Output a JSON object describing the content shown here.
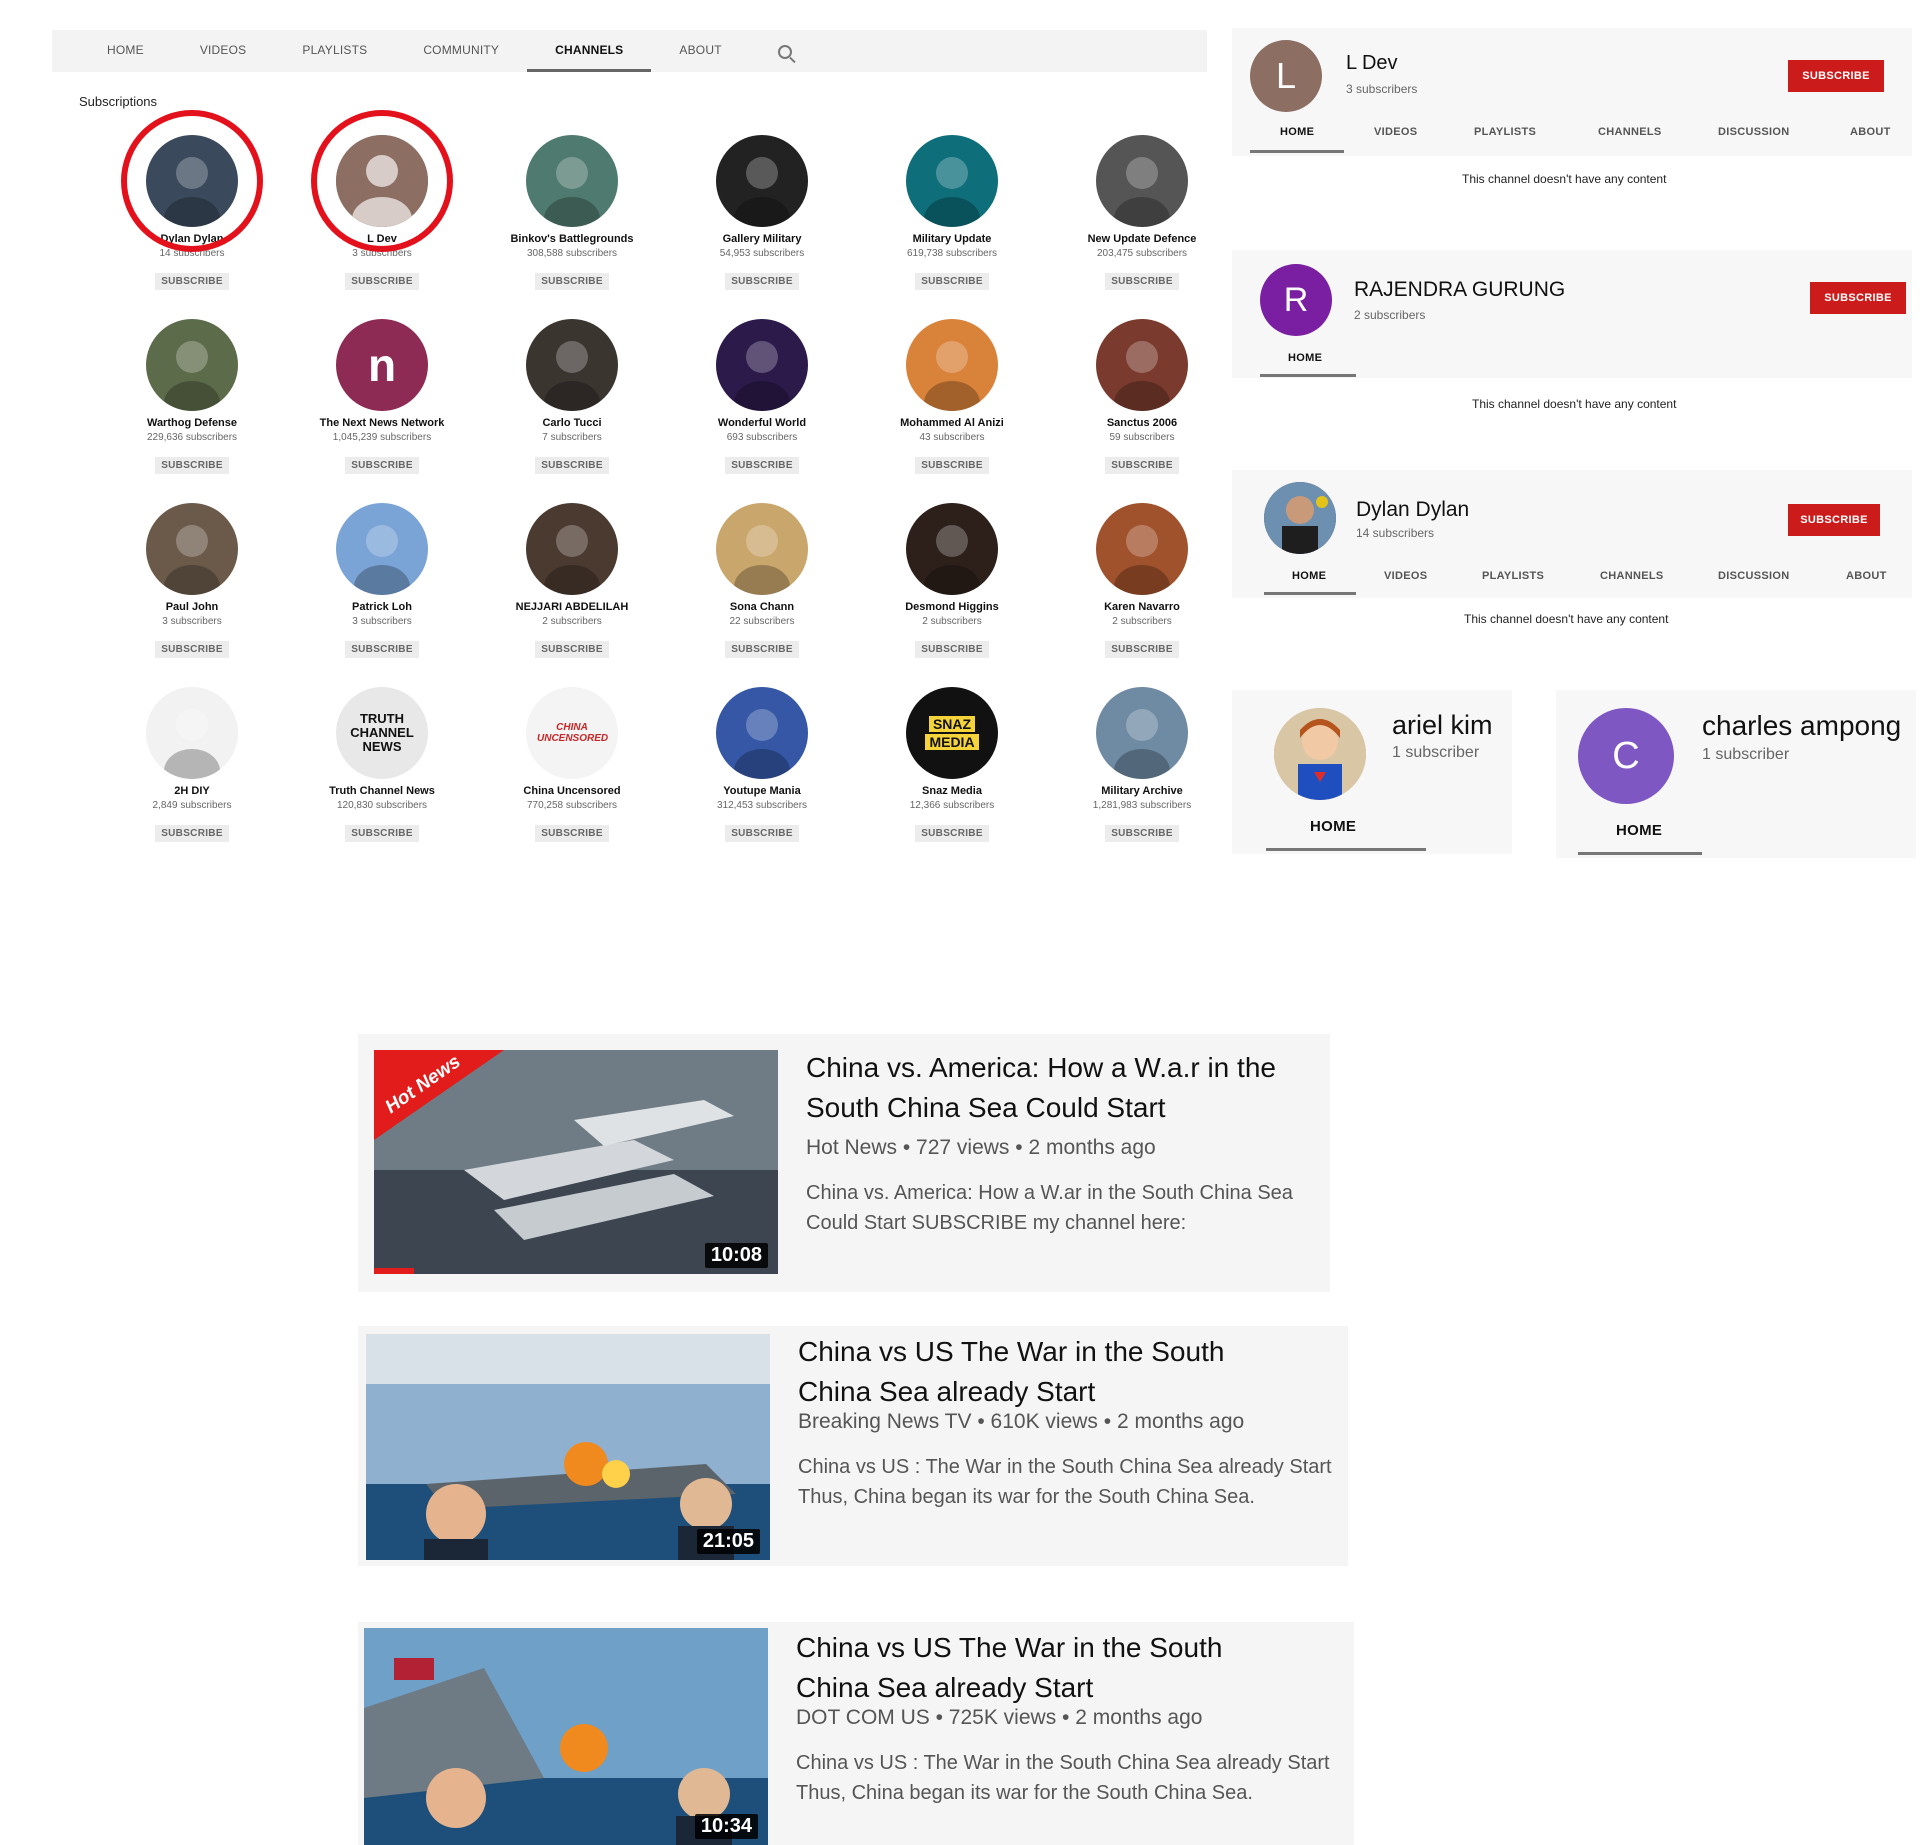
{
  "nav": {
    "tabs": [
      "HOME",
      "VIDEOS",
      "PLAYLISTS",
      "COMMUNITY",
      "CHANNELS",
      "ABOUT"
    ],
    "active_tab": "CHANNELS"
  },
  "subscriptions_heading": "Subscriptions",
  "subscribe_label": "SUBSCRIBE",
  "channels": [
    {
      "name": "Dylan Dylan",
      "subs": "14 subscribers",
      "color": "#3a4a5c"
    },
    {
      "name": "L Dev",
      "subs": "3 subscribers",
      "color": "#8d6e63"
    },
    {
      "name": "Binkov's Battlegrounds",
      "subs": "308,588 subscribers",
      "color": "#4f7a6f"
    },
    {
      "name": "Gallery Military",
      "subs": "54,953 subscribers",
      "color": "#222222"
    },
    {
      "name": "Military Update",
      "subs": "619,738 subscribers",
      "color": "#0e6e7a"
    },
    {
      "name": "New Update Defence",
      "subs": "203,475 subscribers",
      "color": "#555555"
    },
    {
      "name": "Warthog Defense",
      "subs": "229,636 subscribers",
      "color": "#5c6b4a"
    },
    {
      "name": "The Next News Network",
      "subs": "1,045,239 subscribers",
      "color": "#8e2b55"
    },
    {
      "name": "Carlo Tucci",
      "subs": "7 subscribers",
      "color": "#3b3530"
    },
    {
      "name": "Wonderful World",
      "subs": "693 subscribers",
      "color": "#2c1a4a"
    },
    {
      "name": "Mohammed Al Anizi",
      "subs": "43 subscribers",
      "color": "#d9823a"
    },
    {
      "name": "Sanctus 2006",
      "subs": "59 subscribers",
      "color": "#7a3b2e"
    },
    {
      "name": "Paul John",
      "subs": "3 subscribers",
      "color": "#6b5a4a"
    },
    {
      "name": "Patrick Loh",
      "subs": "3 subscribers",
      "color": "#7aa3d6"
    },
    {
      "name": "NEJJARI ABDELILAH",
      "subs": "2 subscribers",
      "color": "#4a3a30"
    },
    {
      "name": "Sona Chann",
      "subs": "22 subscribers",
      "color": "#c9a66b"
    },
    {
      "name": "Desmond Higgins",
      "subs": "2 subscribers",
      "color": "#2d1f1a"
    },
    {
      "name": "Karen Navarro",
      "subs": "2 subscribers",
      "color": "#a0522d"
    },
    {
      "name": "2H DIY",
      "subs": "2,849 subscribers",
      "color": "#f2f2f2"
    },
    {
      "name": "Truth Channel News",
      "subs": "120,830 subscribers",
      "color": "#e8e8e8"
    },
    {
      "name": "China Uncensored",
      "subs": "770,258 subscribers",
      "color": "#f4f4f4"
    },
    {
      "name": "Youtupe Mania",
      "subs": "312,453 subscribers",
      "color": "#3557a6"
    },
    {
      "name": "Snaz Media",
      "subs": "12,366 subscribers",
      "color": "#111111"
    },
    {
      "name": "Military Archive",
      "subs": "1,281,983 subscribers",
      "color": "#6f8aa3"
    }
  ],
  "avatar_texts": {
    "truth": "TRUTH CHANNEL NEWS",
    "china": "CHINA UNCENSORED",
    "snaz1": "SNAZ",
    "snaz2": "MEDIA",
    "nnn": "n"
  },
  "ldev_panel": {
    "initial": "L",
    "name": "L Dev",
    "subs": "3 subscribers",
    "button": "SUBSCRIBE",
    "tabs": [
      "HOME",
      "VIDEOS",
      "PLAYLISTS",
      "CHANNELS",
      "DISCUSSION",
      "ABOUT"
    ],
    "empty": "This channel doesn't have any content"
  },
  "rajendra_panel": {
    "initial": "R",
    "name": "RAJENDRA GURUNG",
    "subs": "2 subscribers",
    "button": "SUBSCRIBE",
    "tab": "HOME",
    "empty": "This channel doesn't have any content"
  },
  "dylan_panel": {
    "name": "Dylan Dylan",
    "subs": "14 subscribers",
    "button": "SUBSCRIBE",
    "tabs": [
      "HOME",
      "VIDEOS",
      "PLAYLISTS",
      "CHANNELS",
      "DISCUSSION",
      "ABOUT"
    ],
    "empty": "This channel doesn't have any content"
  },
  "ariel_panel": {
    "name": "ariel kim",
    "subs": "1 subscriber",
    "tab": "HOME"
  },
  "charles_panel": {
    "initial": "C",
    "name": "charles ampong",
    "subs": "1 subscriber",
    "tab": "HOME"
  },
  "videos": [
    {
      "title": "China vs. America: How a W.a.r in the South China Sea Could Start",
      "meta": "Hot News • 727 views • 2 months ago",
      "desc": "China vs. America: How a W.ar in the South China Sea Could Start SUBSCRIBE my channel here:",
      "duration": "10:08",
      "badge": "Hot News"
    },
    {
      "title": "China vs US The War in the South China Sea already Start",
      "meta": "Breaking News TV • 610K views • 2 months ago",
      "desc": "China vs US : The War in the South China Sea already Start Thus, China began its war for the South China Sea.",
      "duration": "21:05"
    },
    {
      "title": "China vs US The War in the South China Sea already Start",
      "meta": "DOT COM US • 725K views • 2 months ago",
      "desc": "China vs US : The War in the South China Sea already Start Thus, China began its war for the South China Sea.",
      "duration": "10:34"
    }
  ],
  "colors": {
    "accent_red": "#cc1b1b",
    "highlight_ring": "#e3111b",
    "ldev_avatar": "#8d6e63",
    "rajendra_avatar": "#7b1fa2",
    "charles_avatar": "#7e57c2"
  }
}
